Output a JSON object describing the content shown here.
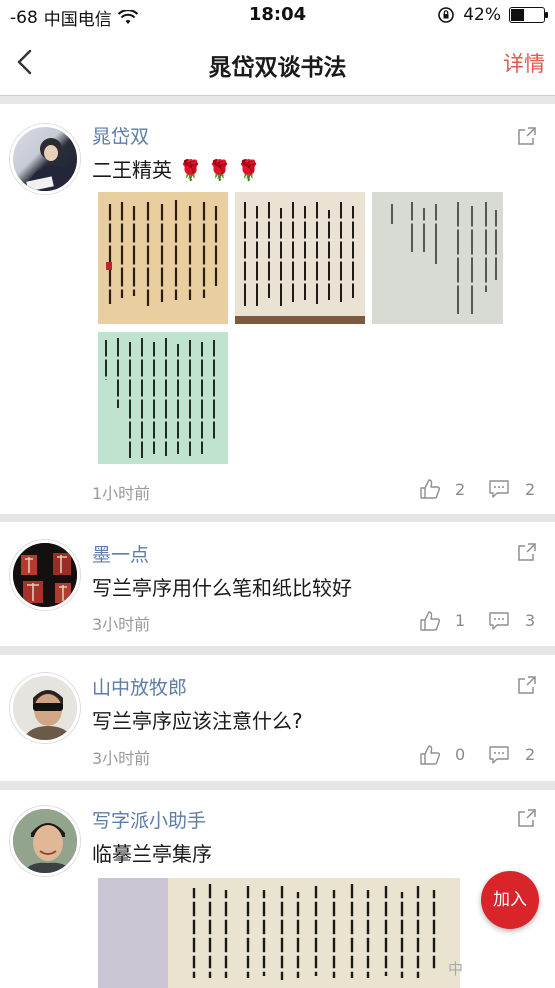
{
  "status_bar": {
    "signal": "-68",
    "carrier": "中国电信",
    "time": "18:04",
    "battery_percent": "42%",
    "battery_level": 0.42
  },
  "nav": {
    "title": "晁岱双谈书法",
    "detail_label": "详情"
  },
  "posts": [
    {
      "username": "晁岱双",
      "text": "二王精英",
      "emoji": "🌹🌹🌹",
      "time": "1小时前",
      "likes": "2",
      "comments": "2"
    },
    {
      "username": "墨一点",
      "text": "写兰亭序用什么笔和纸比较好",
      "time": "3小时前",
      "likes": "1",
      "comments": "3"
    },
    {
      "username": "山中放牧郎",
      "text": "写兰亭序应该注意什么?",
      "time": "3小时前",
      "likes": "0",
      "comments": "2"
    },
    {
      "username": "写字派小助手",
      "text": "临摹兰亭集序"
    }
  ],
  "join_label": "加入",
  "watermark": "中",
  "colors": {
    "accent": "#d9242a",
    "username": "#5d7da6",
    "detail": "#e05a4f"
  }
}
